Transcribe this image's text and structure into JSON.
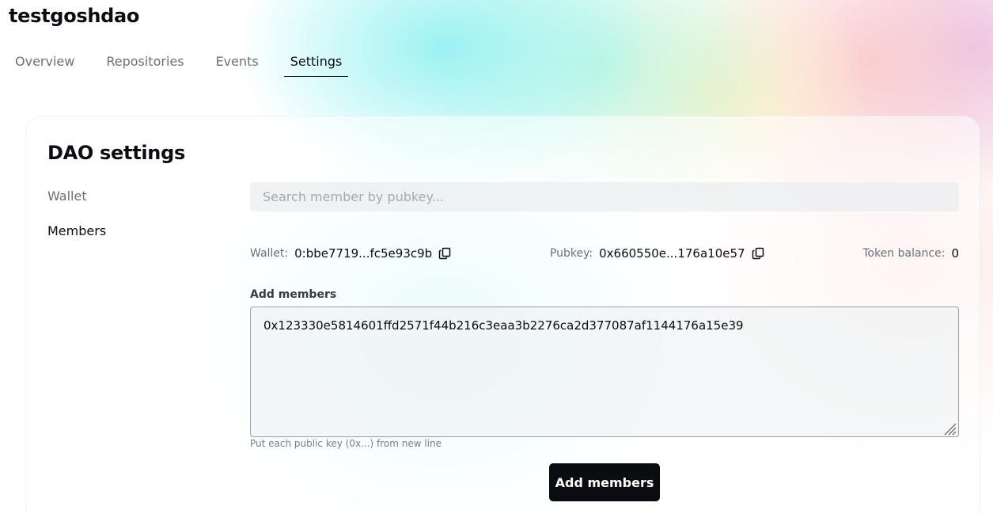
{
  "dao": {
    "name": "testgoshdao"
  },
  "tabs": [
    {
      "label": "Overview",
      "active": false
    },
    {
      "label": "Repositories",
      "active": false
    },
    {
      "label": "Events",
      "active": false
    },
    {
      "label": "Settings",
      "active": true
    }
  ],
  "settings": {
    "title": "DAO settings",
    "nav": [
      {
        "label": "Wallet",
        "active": false
      },
      {
        "label": "Members",
        "active": true
      }
    ]
  },
  "members": {
    "search_placeholder": "Search member by pubkey...",
    "wallet": {
      "label": "Wallet:",
      "value": "0:bbe7719...fc5e93c9b",
      "icon": "copy-icon"
    },
    "pubkey": {
      "label": "Pubkey:",
      "value": "0x660550e...176a10e57",
      "icon": "copy-icon"
    },
    "token_balance": {
      "label": "Token balance:",
      "value": "0"
    },
    "add": {
      "label": "Add members",
      "value": "0x123330e5814601ffd2571f44b216c3eaa3b2276ca2d377087af1144176a15e39",
      "hint": "Put each public key (0x...) from new line",
      "button_label": "Add members"
    }
  },
  "colors": {
    "text_primary": "#0b0b12",
    "text_muted": "#6e6f76",
    "button_bg": "#0b0b12",
    "button_text": "#ffffff"
  }
}
